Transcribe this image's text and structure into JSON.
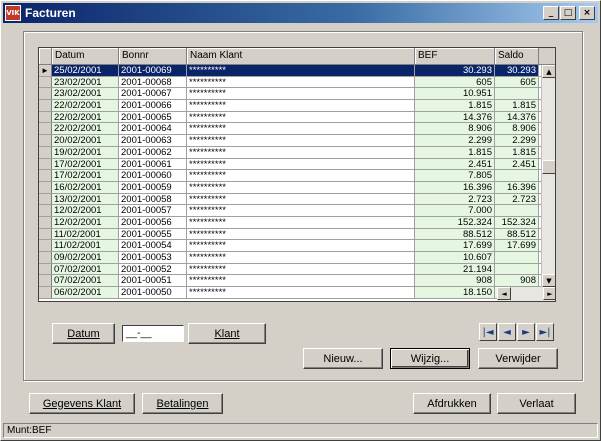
{
  "window": {
    "title": "Facturen",
    "app_icon": "window-app-icon",
    "btn_min": "_",
    "btn_max": "□",
    "btn_close": "×"
  },
  "grid": {
    "columns": [
      "Datum",
      "Bonnr",
      "Naam Klant",
      "BEF",
      "Saldo"
    ],
    "current_row_marker": "►",
    "rows": [
      {
        "datum": "25/02/2001",
        "bonnr": "2001-00069",
        "klant": "**********",
        "bef": "30.293",
        "saldo": "30.293"
      },
      {
        "datum": "23/02/2001",
        "bonnr": "2001-00068",
        "klant": "**********",
        "bef": "605",
        "saldo": "605"
      },
      {
        "datum": "23/02/2001",
        "bonnr": "2001-00067",
        "klant": "**********",
        "bef": "10.951",
        "saldo": ""
      },
      {
        "datum": "22/02/2001",
        "bonnr": "2001-00066",
        "klant": "**********",
        "bef": "1.815",
        "saldo": "1.815"
      },
      {
        "datum": "22/02/2001",
        "bonnr": "2001-00065",
        "klant": "**********",
        "bef": "14.376",
        "saldo": "14.376"
      },
      {
        "datum": "22/02/2001",
        "bonnr": "2001-00064",
        "klant": "**********",
        "bef": "8.906",
        "saldo": "8.906"
      },
      {
        "datum": "20/02/2001",
        "bonnr": "2001-00063",
        "klant": "**********",
        "bef": "2.299",
        "saldo": "2.299"
      },
      {
        "datum": "19/02/2001",
        "bonnr": "2001-00062",
        "klant": "**********",
        "bef": "1.815",
        "saldo": "1.815"
      },
      {
        "datum": "17/02/2001",
        "bonnr": "2001-00061",
        "klant": "**********",
        "bef": "2.451",
        "saldo": "2.451"
      },
      {
        "datum": "17/02/2001",
        "bonnr": "2001-00060",
        "klant": "**********",
        "bef": "7.805",
        "saldo": ""
      },
      {
        "datum": "16/02/2001",
        "bonnr": "2001-00059",
        "klant": "**********",
        "bef": "16.396",
        "saldo": "16.396"
      },
      {
        "datum": "13/02/2001",
        "bonnr": "2001-00058",
        "klant": "**********",
        "bef": "2.723",
        "saldo": "2.723"
      },
      {
        "datum": "12/02/2001",
        "bonnr": "2001-00057",
        "klant": "**********",
        "bef": "7.000",
        "saldo": ""
      },
      {
        "datum": "12/02/2001",
        "bonnr": "2001-00056",
        "klant": "**********",
        "bef": "152.324",
        "saldo": "152.324"
      },
      {
        "datum": "11/02/2001",
        "bonnr": "2001-00055",
        "klant": "**********",
        "bef": "88.512",
        "saldo": "88.512"
      },
      {
        "datum": "11/02/2001",
        "bonnr": "2001-00054",
        "klant": "**********",
        "bef": "17.699",
        "saldo": "17.699"
      },
      {
        "datum": "09/02/2001",
        "bonnr": "2001-00053",
        "klant": "**********",
        "bef": "10.607",
        "saldo": ""
      },
      {
        "datum": "07/02/2001",
        "bonnr": "2001-00052",
        "klant": "**********",
        "bef": "21.194",
        "saldo": ""
      },
      {
        "datum": "07/02/2001",
        "bonnr": "2001-00051",
        "klant": "**********",
        "bef": "908",
        "saldo": "908"
      },
      {
        "datum": "06/02/2001",
        "bonnr": "2001-00050",
        "klant": "**********",
        "bef": "18.150",
        "saldo": ""
      }
    ]
  },
  "search": {
    "datum_button": "Datum",
    "date_value": "__-__",
    "klant_button": "Klant"
  },
  "nav": {
    "first": "|◄",
    "prev": "◄",
    "next": "►",
    "last": "►|"
  },
  "actions": {
    "nieuw": "Nieuw...",
    "wijzig": "Wijzig...",
    "verwijder": "Verwijder"
  },
  "footer": {
    "gegevens_klant": "Gegevens Klant",
    "betalingen": "Betalingen",
    "afdrukken": "Afdrukken",
    "verlaat": "Verlaat"
  },
  "status": "Munt:BEF",
  "colors": {
    "selection": "#0a246a",
    "row_green": "#e6f7e1",
    "titlebar": "#0a246a"
  }
}
